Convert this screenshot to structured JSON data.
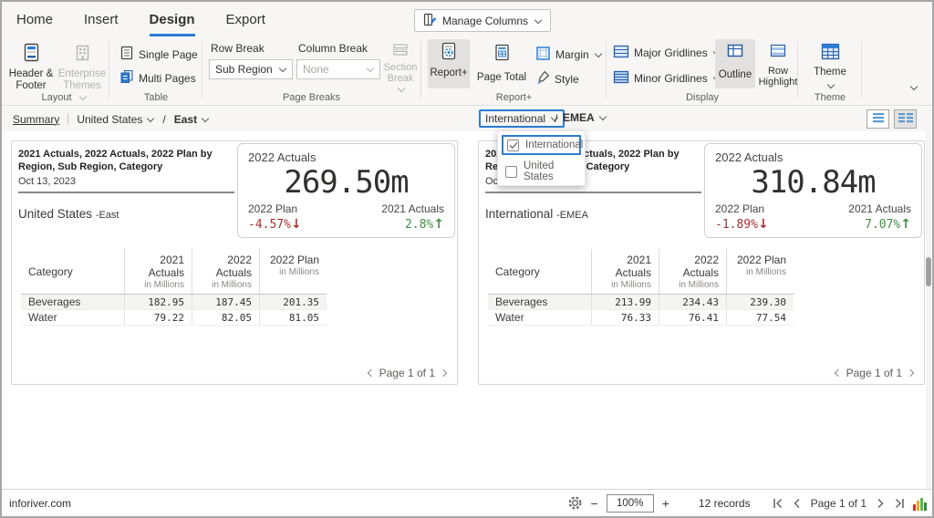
{
  "window": {
    "tabs": [
      {
        "label": "Home"
      },
      {
        "label": "Insert"
      },
      {
        "label": "Design",
        "active": true
      },
      {
        "label": "Export"
      }
    ],
    "manage_columns_label": "Manage Columns"
  },
  "ribbon": {
    "layout": {
      "label": "Layout",
      "header_footer": "Header & Footer",
      "enterprise_themes": "Enterprise Themes"
    },
    "table": {
      "label": "Table",
      "single_page": "Single Page",
      "multi_pages": "Multi Pages"
    },
    "page_breaks": {
      "label": "Page Breaks",
      "row_break_label": "Row Break",
      "row_break_value": "Sub Region",
      "column_break_label": "Column Break",
      "column_break_value": "None",
      "section_break": "Section Break"
    },
    "report_plus": {
      "label": "Report+",
      "report_plus": "Report+",
      "page_total": "Page Total",
      "margin": "Margin",
      "style": "Style"
    },
    "display": {
      "label": "Display",
      "major_gridlines": "Major Gridlines",
      "minor_gridlines": "Minor Gridlines",
      "outline": "Outline",
      "row_highlight": "Row Highlight"
    },
    "theme": {
      "label": "Theme",
      "button": "Theme"
    }
  },
  "breadcrumb": {
    "summary": "Summary",
    "region": "United States",
    "separator": "/",
    "subregion": "East",
    "filter_region": "International",
    "filter_separator": "/",
    "filter_subregion": "EMEA"
  },
  "dropdown": {
    "items": [
      {
        "label": "International",
        "checked": true
      },
      {
        "label": "United States",
        "checked": false
      }
    ]
  },
  "panels": [
    {
      "title": "2021 Actuals, 2022 Actuals, 2022 Plan by Region, Sub Region, Category",
      "date": "Oct 13, 2023",
      "region": "United States",
      "region_suffix": "-East",
      "kpi": {
        "label": "2022 Actuals",
        "value": "269.50m",
        "left_label": "2022 Plan",
        "left_value": "-4.57%",
        "left_arrow": "↓",
        "right_label": "2021 Actuals",
        "right_value": "2.8%",
        "right_arrow": "↑"
      },
      "table": {
        "col0": "Category",
        "headers": [
          {
            "line1": "2021 Actuals",
            "line2": "in Millions"
          },
          {
            "line1": "2022 Actuals",
            "line2": "in Millions"
          },
          {
            "line1": "2022 Plan",
            "line2": "in Millions"
          }
        ],
        "rows": [
          {
            "name": "Beverages",
            "v1": "182.95",
            "v2": "187.45",
            "v3": "201.35"
          },
          {
            "name": "Water",
            "v1": "79.22",
            "v2": "82.05",
            "v3": "81.05"
          }
        ]
      },
      "pager": "Page 1 of 1"
    },
    {
      "title": "2021 Actuals, 2022 Actuals, 2022 Plan by Region, Sub Region, Category",
      "date": "Oct 13, 2023",
      "region": "International",
      "region_suffix": "-EMEA",
      "kpi": {
        "label": "2022 Actuals",
        "value": "310.84m",
        "left_label": "2022 Plan",
        "left_value": "-1.89%",
        "left_arrow": "↓",
        "right_label": "2021 Actuals",
        "right_value": "7.07%",
        "right_arrow": "↑"
      },
      "table": {
        "col0": "Category",
        "headers": [
          {
            "line1": "2021 Actuals",
            "line2": "in Millions"
          },
          {
            "line1": "2022 Actuals",
            "line2": "in Millions"
          },
          {
            "line1": "2022 Plan",
            "line2": "in Millions"
          }
        ],
        "rows": [
          {
            "name": "Beverages",
            "v1": "213.99",
            "v2": "234.43",
            "v3": "239.30"
          },
          {
            "name": "Water",
            "v1": "76.33",
            "v2": "76.41",
            "v3": "77.54"
          }
        ]
      },
      "pager": "Page 1 of 1"
    }
  ],
  "statusbar": {
    "site": "inforiver.com",
    "zoom_out": "−",
    "zoom_value": "100%",
    "zoom_in": "+",
    "records": "12 records",
    "page": "Page 1 of 1"
  },
  "colors": {
    "accent": "#2b7cd3",
    "negative": "#a83232",
    "positive": "#3f8f44"
  }
}
